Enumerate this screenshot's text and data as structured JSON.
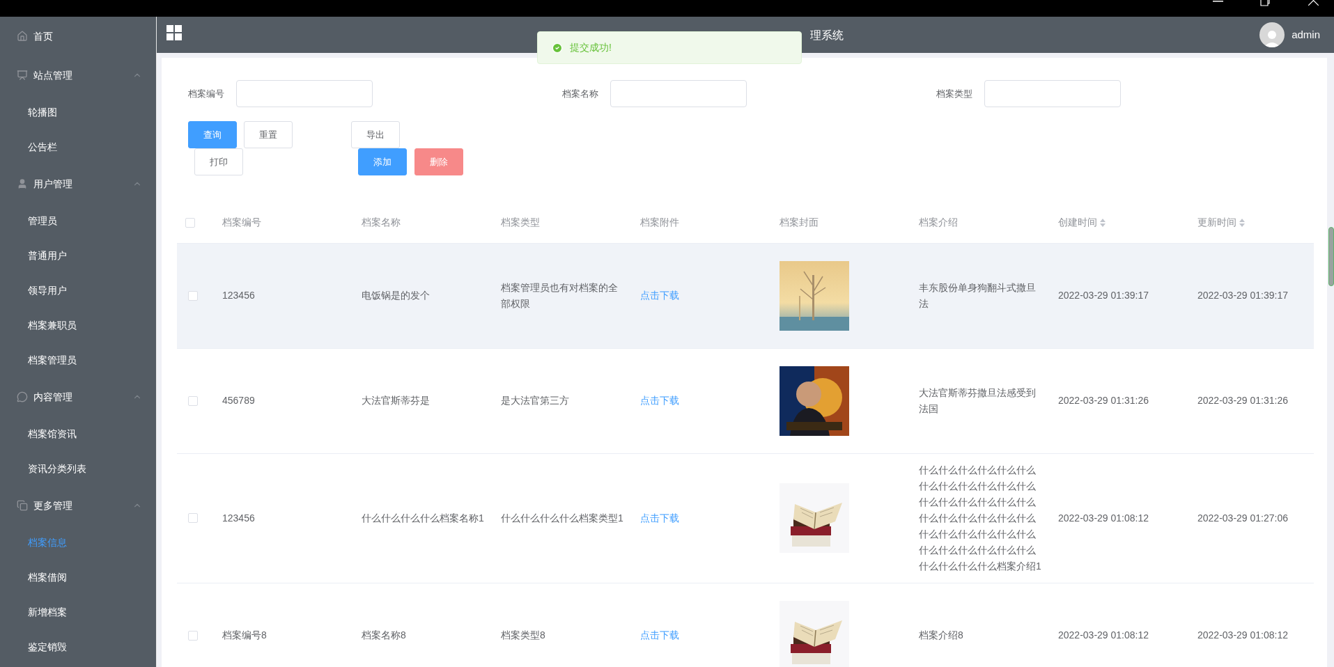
{
  "header": {
    "title": "理系统",
    "user": "admin"
  },
  "toast": {
    "kind": "success",
    "message": "提交成功!"
  },
  "sidebar": {
    "items": [
      {
        "label": "首页"
      },
      {
        "label": "站点管理",
        "expanded": true,
        "children": [
          {
            "label": "轮播图",
            "selected": false
          },
          {
            "label": "公告栏",
            "selected": false
          }
        ]
      },
      {
        "label": "用户管理",
        "expanded": true,
        "children": [
          {
            "label": "管理员",
            "selected": false
          },
          {
            "label": "普通用户",
            "selected": false
          },
          {
            "label": "领导用户",
            "selected": false
          },
          {
            "label": "档案兼职员",
            "selected": false
          },
          {
            "label": "档案管理员",
            "selected": false
          }
        ]
      },
      {
        "label": "内容管理",
        "expanded": true,
        "children": [
          {
            "label": "档案馆资讯",
            "selected": false
          },
          {
            "label": "资讯分类列表",
            "selected": false
          }
        ]
      },
      {
        "label": "更多管理",
        "expanded": true,
        "children": [
          {
            "label": "档案信息",
            "selected": true
          },
          {
            "label": "档案借阅",
            "selected": false
          },
          {
            "label": "新增档案",
            "selected": false
          },
          {
            "label": "鉴定销毁",
            "selected": false
          }
        ]
      }
    ]
  },
  "search_form": {
    "fields": [
      {
        "label": "档案编号"
      },
      {
        "label": "档案名称"
      },
      {
        "label": "档案类型"
      }
    ],
    "button_rows": [
      [
        {
          "label": "查询",
          "kind": "primary"
        },
        {
          "label": "重置",
          "kind": "plain"
        },
        {
          "label": "导出",
          "kind": "plain"
        }
      ],
      [
        {
          "label": "打印",
          "kind": "plain"
        },
        {
          "label": "添加",
          "kind": "primary"
        },
        {
          "label": "删除",
          "kind": "danger"
        }
      ]
    ]
  },
  "table": {
    "select_all": {
      "checked": false
    },
    "columns": [
      {
        "label": "档案编号",
        "sortable": false
      },
      {
        "label": "档案名称",
        "sortable": false
      },
      {
        "label": "档案类型",
        "sortable": false
      },
      {
        "label": "档案附件",
        "sortable": false
      },
      {
        "label": "档案封面",
        "sortable": false
      },
      {
        "label": "档案介绍",
        "sortable": false
      },
      {
        "label": "创建时间",
        "sortable": true
      },
      {
        "label": "更新时间",
        "sortable": true
      }
    ],
    "rows": [
      {
        "checked": false,
        "hovered": true,
        "code": "123456",
        "name": "电饭锅是的发个",
        "type": "档案管理员也有对档案的全部权限",
        "attachment": "点击下载",
        "intro": "丰东股份单身狗翻斗式撒旦法",
        "created": "2022-03-29 01:39:17",
        "updated": "2022-03-29 01:39:17"
      },
      {
        "checked": false,
        "hovered": false,
        "code": "456789",
        "name": "大法官斯蒂芬是",
        "type": "是大法官第三方",
        "attachment": "点击下载",
        "intro": "大法官斯蒂芬撒旦法感受到法国",
        "created": "2022-03-29 01:31:26",
        "updated": "2022-03-29 01:31:26"
      },
      {
        "checked": false,
        "hovered": false,
        "code": "123456",
        "name": "什么什么什么什么档案名称1",
        "type": "什么什么什么什么档案类型1",
        "attachment": "点击下载",
        "intro": "什么什么什么什么什么什么什么什么什么什么什么什么什么什么什么什么什么什么什么什么什么什么什么什么什么什么什么什么什么什么什么什么什么什么什么什么什么什么什么什么档案介绍1",
        "created": "2022-03-29 01:08:12",
        "updated": "2022-03-29 01:27:06"
      },
      {
        "checked": false,
        "hovered": false,
        "code": "档案编号8",
        "name": "档案名称8",
        "type": "档案类型8",
        "attachment": "点击下载",
        "intro": "档案介绍8",
        "created": "2022-03-29 01:08:12",
        "updated": "2022-03-29 01:08:12"
      }
    ]
  }
}
